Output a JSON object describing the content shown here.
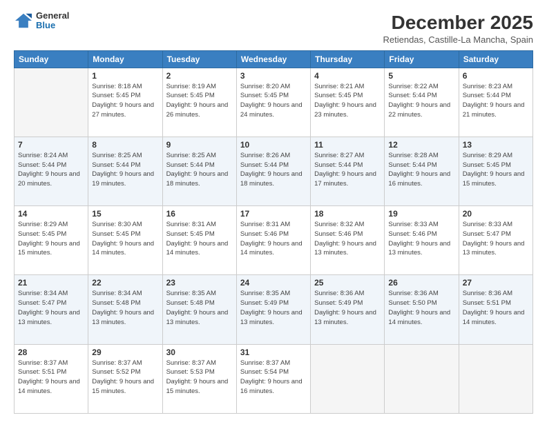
{
  "header": {
    "logo_line1": "General",
    "logo_line2": "Blue",
    "main_title": "December 2025",
    "subtitle": "Retiendas, Castille-La Mancha, Spain"
  },
  "days_of_week": [
    "Sunday",
    "Monday",
    "Tuesday",
    "Wednesday",
    "Thursday",
    "Friday",
    "Saturday"
  ],
  "weeks": [
    [
      {
        "day": "",
        "sunrise": "",
        "sunset": "",
        "daylight": "",
        "empty": true
      },
      {
        "day": "1",
        "sunrise": "Sunrise: 8:18 AM",
        "sunset": "Sunset: 5:45 PM",
        "daylight": "Daylight: 9 hours and 27 minutes."
      },
      {
        "day": "2",
        "sunrise": "Sunrise: 8:19 AM",
        "sunset": "Sunset: 5:45 PM",
        "daylight": "Daylight: 9 hours and 26 minutes."
      },
      {
        "day": "3",
        "sunrise": "Sunrise: 8:20 AM",
        "sunset": "Sunset: 5:45 PM",
        "daylight": "Daylight: 9 hours and 24 minutes."
      },
      {
        "day": "4",
        "sunrise": "Sunrise: 8:21 AM",
        "sunset": "Sunset: 5:45 PM",
        "daylight": "Daylight: 9 hours and 23 minutes."
      },
      {
        "day": "5",
        "sunrise": "Sunrise: 8:22 AM",
        "sunset": "Sunset: 5:44 PM",
        "daylight": "Daylight: 9 hours and 22 minutes."
      },
      {
        "day": "6",
        "sunrise": "Sunrise: 8:23 AM",
        "sunset": "Sunset: 5:44 PM",
        "daylight": "Daylight: 9 hours and 21 minutes."
      }
    ],
    [
      {
        "day": "7",
        "sunrise": "Sunrise: 8:24 AM",
        "sunset": "Sunset: 5:44 PM",
        "daylight": "Daylight: 9 hours and 20 minutes."
      },
      {
        "day": "8",
        "sunrise": "Sunrise: 8:25 AM",
        "sunset": "Sunset: 5:44 PM",
        "daylight": "Daylight: 9 hours and 19 minutes."
      },
      {
        "day": "9",
        "sunrise": "Sunrise: 8:25 AM",
        "sunset": "Sunset: 5:44 PM",
        "daylight": "Daylight: 9 hours and 18 minutes."
      },
      {
        "day": "10",
        "sunrise": "Sunrise: 8:26 AM",
        "sunset": "Sunset: 5:44 PM",
        "daylight": "Daylight: 9 hours and 18 minutes."
      },
      {
        "day": "11",
        "sunrise": "Sunrise: 8:27 AM",
        "sunset": "Sunset: 5:44 PM",
        "daylight": "Daylight: 9 hours and 17 minutes."
      },
      {
        "day": "12",
        "sunrise": "Sunrise: 8:28 AM",
        "sunset": "Sunset: 5:44 PM",
        "daylight": "Daylight: 9 hours and 16 minutes."
      },
      {
        "day": "13",
        "sunrise": "Sunrise: 8:29 AM",
        "sunset": "Sunset: 5:45 PM",
        "daylight": "Daylight: 9 hours and 15 minutes."
      }
    ],
    [
      {
        "day": "14",
        "sunrise": "Sunrise: 8:29 AM",
        "sunset": "Sunset: 5:45 PM",
        "daylight": "Daylight: 9 hours and 15 minutes."
      },
      {
        "day": "15",
        "sunrise": "Sunrise: 8:30 AM",
        "sunset": "Sunset: 5:45 PM",
        "daylight": "Daylight: 9 hours and 14 minutes."
      },
      {
        "day": "16",
        "sunrise": "Sunrise: 8:31 AM",
        "sunset": "Sunset: 5:45 PM",
        "daylight": "Daylight: 9 hours and 14 minutes."
      },
      {
        "day": "17",
        "sunrise": "Sunrise: 8:31 AM",
        "sunset": "Sunset: 5:46 PM",
        "daylight": "Daylight: 9 hours and 14 minutes."
      },
      {
        "day": "18",
        "sunrise": "Sunrise: 8:32 AM",
        "sunset": "Sunset: 5:46 PM",
        "daylight": "Daylight: 9 hours and 13 minutes."
      },
      {
        "day": "19",
        "sunrise": "Sunrise: 8:33 AM",
        "sunset": "Sunset: 5:46 PM",
        "daylight": "Daylight: 9 hours and 13 minutes."
      },
      {
        "day": "20",
        "sunrise": "Sunrise: 8:33 AM",
        "sunset": "Sunset: 5:47 PM",
        "daylight": "Daylight: 9 hours and 13 minutes."
      }
    ],
    [
      {
        "day": "21",
        "sunrise": "Sunrise: 8:34 AM",
        "sunset": "Sunset: 5:47 PM",
        "daylight": "Daylight: 9 hours and 13 minutes."
      },
      {
        "day": "22",
        "sunrise": "Sunrise: 8:34 AM",
        "sunset": "Sunset: 5:48 PM",
        "daylight": "Daylight: 9 hours and 13 minutes."
      },
      {
        "day": "23",
        "sunrise": "Sunrise: 8:35 AM",
        "sunset": "Sunset: 5:48 PM",
        "daylight": "Daylight: 9 hours and 13 minutes."
      },
      {
        "day": "24",
        "sunrise": "Sunrise: 8:35 AM",
        "sunset": "Sunset: 5:49 PM",
        "daylight": "Daylight: 9 hours and 13 minutes."
      },
      {
        "day": "25",
        "sunrise": "Sunrise: 8:36 AM",
        "sunset": "Sunset: 5:49 PM",
        "daylight": "Daylight: 9 hours and 13 minutes."
      },
      {
        "day": "26",
        "sunrise": "Sunrise: 8:36 AM",
        "sunset": "Sunset: 5:50 PM",
        "daylight": "Daylight: 9 hours and 14 minutes."
      },
      {
        "day": "27",
        "sunrise": "Sunrise: 8:36 AM",
        "sunset": "Sunset: 5:51 PM",
        "daylight": "Daylight: 9 hours and 14 minutes."
      }
    ],
    [
      {
        "day": "28",
        "sunrise": "Sunrise: 8:37 AM",
        "sunset": "Sunset: 5:51 PM",
        "daylight": "Daylight: 9 hours and 14 minutes."
      },
      {
        "day": "29",
        "sunrise": "Sunrise: 8:37 AM",
        "sunset": "Sunset: 5:52 PM",
        "daylight": "Daylight: 9 hours and 15 minutes."
      },
      {
        "day": "30",
        "sunrise": "Sunrise: 8:37 AM",
        "sunset": "Sunset: 5:53 PM",
        "daylight": "Daylight: 9 hours and 15 minutes."
      },
      {
        "day": "31",
        "sunrise": "Sunrise: 8:37 AM",
        "sunset": "Sunset: 5:54 PM",
        "daylight": "Daylight: 9 hours and 16 minutes."
      },
      {
        "day": "",
        "sunrise": "",
        "sunset": "",
        "daylight": "",
        "empty": true
      },
      {
        "day": "",
        "sunrise": "",
        "sunset": "",
        "daylight": "",
        "empty": true
      },
      {
        "day": "",
        "sunrise": "",
        "sunset": "",
        "daylight": "",
        "empty": true
      }
    ]
  ]
}
